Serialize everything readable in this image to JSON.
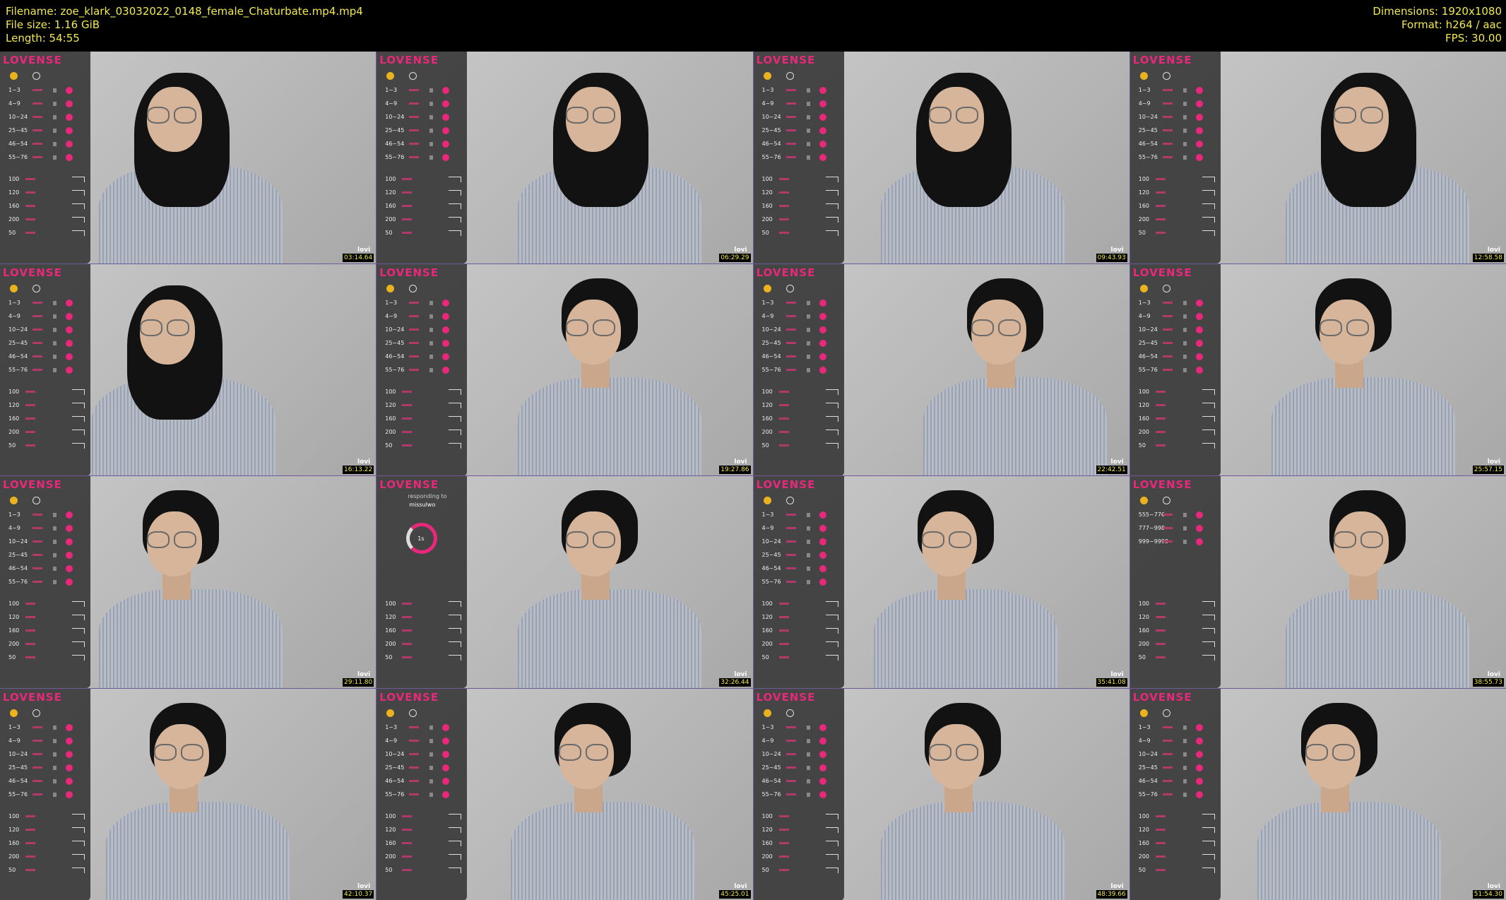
{
  "header": {
    "filename_line": "Filename: zoe_klark_03032022_0148_female_Chaturbate.mp4.mp4",
    "filesize_line": "File size: 1.16 GiB",
    "length_line": "Length: 54:55",
    "dimensions_line": "Dimensions: 1920x1080",
    "format_line": "Format: h264 / aac",
    "fps_line": "FPS: 30.00"
  },
  "panel": {
    "logo": "LOVENSE",
    "levels": [
      "1~3",
      "4~9",
      "10~24",
      "25~45",
      "46~54",
      "55~76"
    ],
    "special_levels": [
      "555~776",
      "777~998",
      "999~9999"
    ],
    "speeds": [
      "100",
      "120",
      "160",
      "200",
      "50"
    ],
    "responding_label": "responding to",
    "responding_user": "missulwo",
    "countdown": "1s"
  },
  "watermark": "lovi",
  "thumbnails": [
    {
      "time": "03:14.64",
      "variant": "normal",
      "hair": "down"
    },
    {
      "time": "06:29.29",
      "variant": "normal",
      "hair": "down"
    },
    {
      "time": "09:43.93",
      "variant": "normal",
      "hair": "down"
    },
    {
      "time": "12:58.58",
      "variant": "normal",
      "hair": "down"
    },
    {
      "time": "16:13.22",
      "variant": "normal",
      "hair": "down"
    },
    {
      "time": "19:27.86",
      "variant": "normal",
      "hair": "up"
    },
    {
      "time": "22:42.51",
      "variant": "normal",
      "hair": "up"
    },
    {
      "time": "25:57.15",
      "variant": "normal",
      "hair": "up"
    },
    {
      "time": "29:11.80",
      "variant": "normal",
      "hair": "up"
    },
    {
      "time": "32:26.44",
      "variant": "responding",
      "hair": "up"
    },
    {
      "time": "35:41.08",
      "variant": "normal",
      "hair": "up"
    },
    {
      "time": "38:55.73",
      "variant": "special",
      "hair": "up"
    },
    {
      "time": "42:10.37",
      "variant": "normal",
      "hair": "up"
    },
    {
      "time": "45:25.01",
      "variant": "normal",
      "hair": "up"
    },
    {
      "time": "48:39.66",
      "variant": "normal",
      "hair": "up"
    },
    {
      "time": "51:54.30",
      "variant": "normal",
      "hair": "up"
    }
  ],
  "colors": {
    "header_text": "#f2e94e",
    "lovense_pink": "#e8287a",
    "grid_border": "#6c5a9a"
  }
}
